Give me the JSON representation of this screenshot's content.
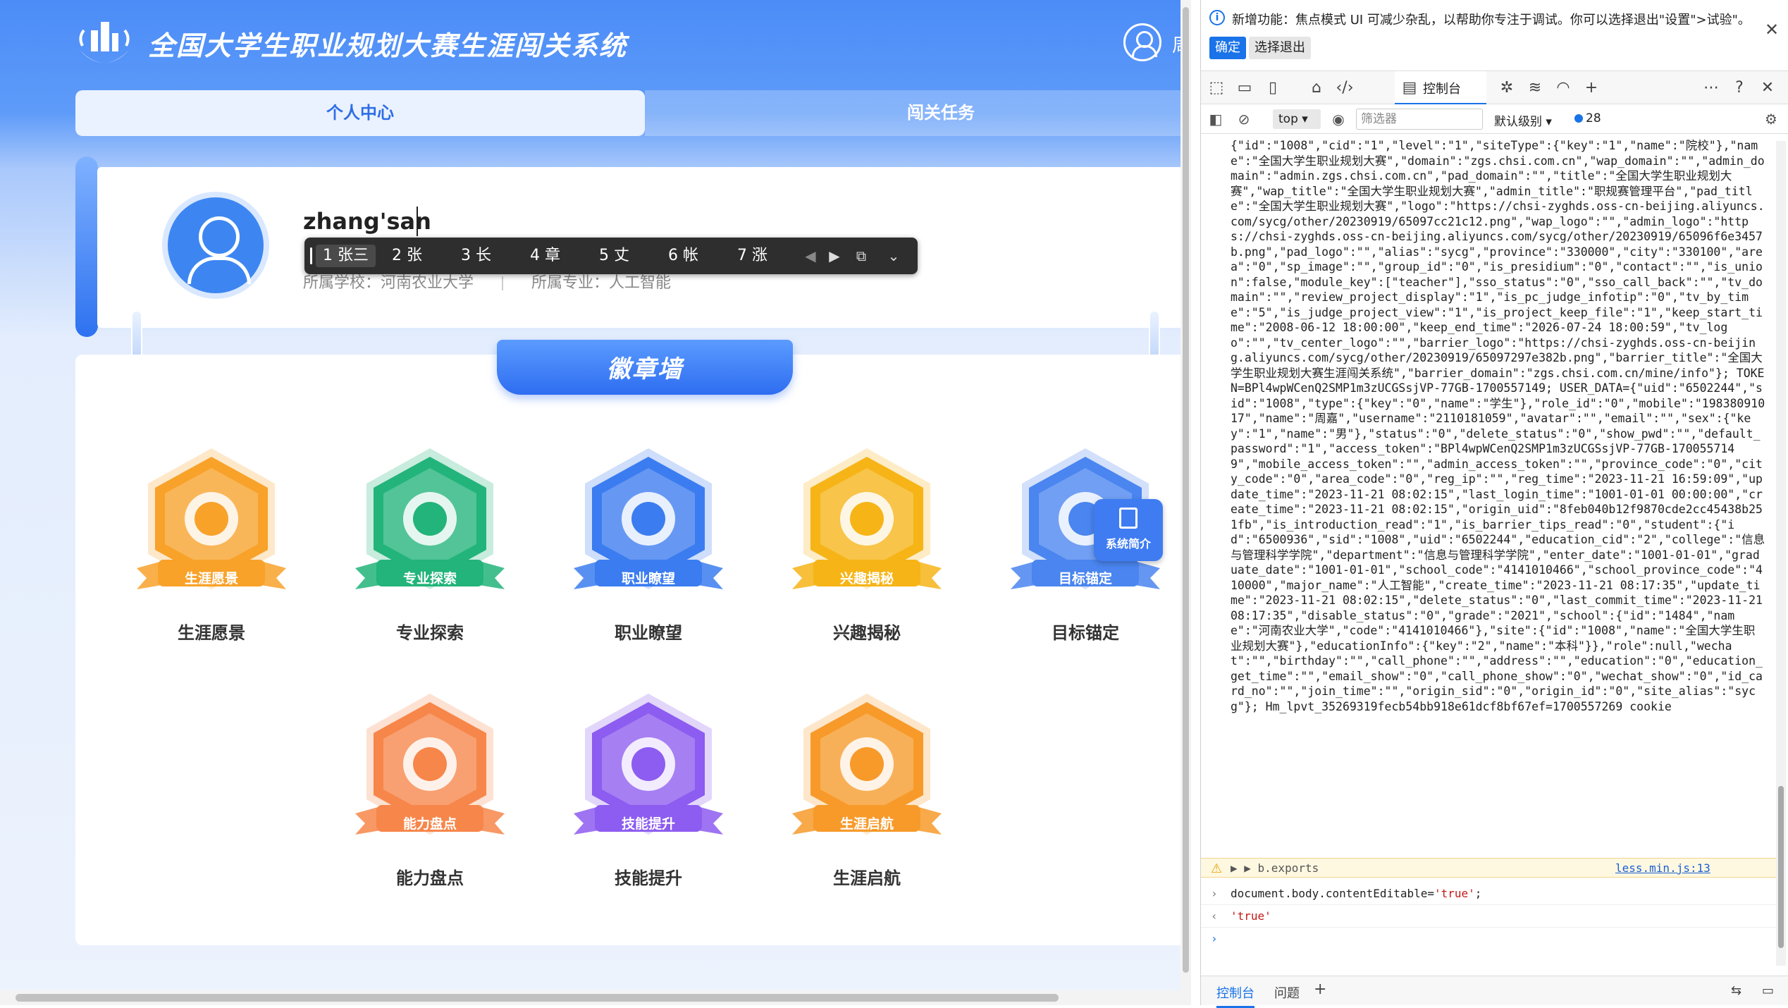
{
  "app": {
    "site_title": "全国大学生职业规划大赛生涯闯关系统",
    "user_name_top": "周",
    "tabs": [
      {
        "label": "个人中心",
        "active": true
      },
      {
        "label": "闯关任务",
        "active": false
      }
    ],
    "profile": {
      "name_value": "zhang'san",
      "school_label": "所属学校：河南农业大学",
      "major_label": "所属专业：人工智能"
    },
    "ime": {
      "candidates": [
        "1 张三",
        "2 张",
        "3 长",
        "4 章",
        "5 丈",
        "6 帐",
        "7 涨"
      ]
    },
    "wall_title": "徽章墙",
    "badges": [
      {
        "ribbon": "生涯愿景",
        "label": "生涯愿景",
        "color": "#f8a22a",
        "icon": "heart-icon"
      },
      {
        "ribbon": "专业探索",
        "label": "专业探索",
        "color": "#22b47a",
        "icon": "book-icon"
      },
      {
        "ribbon": "职业瞭望",
        "label": "职业瞭望",
        "color": "#3b7cf0",
        "icon": "globe-icon"
      },
      {
        "ribbon": "兴趣揭秘",
        "label": "兴趣揭秘",
        "color": "#f6b417",
        "icon": "bulb-icon"
      },
      {
        "ribbon": "目标锚定",
        "label": "目标锚定",
        "color": "#4a85f0",
        "icon": "target-icon",
        "tooltip": "系统简介"
      },
      {
        "ribbon": "能力盘点",
        "label": "能力盘点",
        "color": "#f7864a",
        "icon": "clipboard-icon"
      },
      {
        "ribbon": "技能提升",
        "label": "技能提升",
        "color": "#8d5cf0",
        "icon": "blocks-icon"
      },
      {
        "ribbon": "生涯启航",
        "label": "生涯启航",
        "color": "#f79a2a",
        "icon": "shoe-icon"
      }
    ]
  },
  "devtools": {
    "info_text": "新增功能：焦点模式 UI 可减少杂乱，以帮助你专注于调试。你可以选择退出\"设置\">试验\"。",
    "ok_label": "确定",
    "exit_label": "选择退出",
    "console_tab_label": "控制台",
    "context_label": "top",
    "filter_placeholder": "筛选器",
    "level_label": "默认级别",
    "issue_count": "28",
    "console_output": "{\"id\":\"1008\",\"cid\":\"1\",\"level\":\"1\",\"siteType\":{\"key\":\"1\",\"name\":\"院校\"},\"name\":\"全国大学生职业规划大赛\",\"domain\":\"zgs.chsi.com.cn\",\"wap_domain\":\"\",\"admin_domain\":\"admin.zgs.chsi.com.cn\",\"pad_domain\":\"\",\"title\":\"全国大学生职业规划大赛\",\"wap_title\":\"全国大学生职业规划大赛\",\"admin_title\":\"职规赛管理平台\",\"pad_title\":\"全国大学生职业规划大赛\",\"logo\":\"https://chsi-zyghds.oss-cn-beijing.aliyuncs.com/sycg/other/20230919/65097cc21c12.png\",\"wap_logo\":\"\",\"admin_logo\":\"https://chsi-zyghds.oss-cn-beijing.aliyuncs.com/sycg/other/20230919/65096f6e3457b.png\",\"pad_logo\":\"\",\"alias\":\"sycg\",\"province\":\"330000\",\"city\":\"330100\",\"area\":\"0\",\"sp_image\":\"\",\"group_id\":\"0\",\"is_presidium\":\"0\",\"contact\":\"\",\"is_union\":false,\"module_key\":[\"teacher\"],\"sso_status\":\"0\",\"sso_call_back\":\"\",\"tv_domain\":\"\",\"review_project_display\":\"1\",\"is_pc_judge_infotip\":\"0\",\"tv_by_time\":\"5\",\"is_judge_project_view\":\"1\",\"is_project_keep_file\":\"1\",\"keep_start_time\":\"2008-06-12 18:00:00\",\"keep_end_time\":\"2026-07-24 18:00:59\",\"tv_logo\":\"\",\"tv_center_logo\":\"\",\"barrier_logo\":\"https://chsi-zyghds.oss-cn-beijing.aliyuncs.com/sycg/other/20230919/65097297e382b.png\",\"barrier_title\":\"全国大学生职业规划大赛生涯闯关系统\",\"barrier_domain\":\"zgs.chsi.com.cn/mine/info\"}; TOKEN=BPl4wpWCenQ2SMP1m3zUCGSsjVP-77GB-1700557149; USER_DATA={\"uid\":\"6502244\",\"sid\":\"1008\",\"type\":{\"key\":\"0\",\"name\":\"学生\"},\"role_id\":\"0\",\"mobile\":\"19838091017\",\"name\":\"周嘉\",\"username\":\"2110181059\",\"avatar\":\"\",\"email\":\"\",\"sex\":{\"key\":\"1\",\"name\":\"男\"},\"status\":\"0\",\"delete_status\":\"0\",\"show_pwd\":\"\",\"default_password\":\"1\",\"access_token\":\"BPl4wpWCenQ2SMP1m3zUCGSsjVP-77GB-1700557149\",\"mobile_access_token\":\"\",\"admin_access_token\":\"\",\"province_code\":\"0\",\"city_code\":\"0\",\"area_code\":\"0\",\"reg_ip\":\"\",\"reg_time\":\"2023-11-21 16:59:09\",\"update_time\":\"2023-11-21 08:02:15\",\"last_login_time\":\"1001-01-01 00:00:00\",\"create_time\":\"2023-11-21 08:02:15\",\"origin_uid\":\"8feb040b12f9870cde2cc45438b251fb\",\"is_introduction_read\":\"1\",\"is_barrier_tips_read\":\"0\",\"student\":{\"id\":\"6500936\",\"sid\":\"1008\",\"uid\":\"6502244\",\"education_cid\":\"2\",\"college\":\"信息与管理科学学院\",\"department\":\"信息与管理科学学院\",\"enter_date\":\"1001-01-01\",\"graduate_date\":\"1001-01-01\",\"school_code\":\"4141010466\",\"school_province_code\":\"410000\",\"major_name\":\"人工智能\",\"create_time\":\"2023-11-21 08:17:35\",\"update_time\":\"2023-11-21 08:02:15\",\"delete_status\":\"0\",\"last_commit_time\":\"2023-11-21 08:17:35\",\"disable_status\":\"0\",\"grade\":\"2021\",\"school\":{\"id\":\"1484\",\"name\":\"河南农业大学\",\"code\":\"4141010466\"},\"site\":{\"id\":\"1008\",\"name\":\"全国大学生职业规划大赛\"},\"educationInfo\":{\"key\":\"2\",\"name\":\"本科\"}},\"role\":null,\"wechat\":\"\",\"birthday\":\"\",\"call_phone\":\"\",\"address\":\"\",\"education\":\"0\",\"education_get_time\":\"\",\"email_show\":\"0\",\"call_phone_show\":\"0\",\"wechat_show\":\"0\",\"id_card_no\":\"\",\"join_time\":\"\",\"origin_sid\":\"0\",\"origin_id\":\"0\",\"site_alias\":\"sycg\"}; Hm_lpvt_35269319fecb54bb918e61dcf8bf67ef=1700557269 cookie",
    "warn_text": "▶ ▶ b.exports",
    "warn_source": "less.min.js:13",
    "command_prefix": "document.",
    "command_body": "body.contentEditable=",
    "command_value": "'true'",
    "command_suffix": ";",
    "result_value": "'true'",
    "bottom_tabs": [
      "控制台",
      "问题"
    ]
  }
}
